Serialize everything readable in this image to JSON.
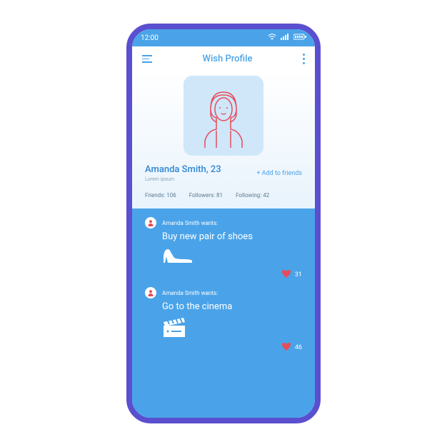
{
  "status": {
    "time": "12:00"
  },
  "header": {
    "title": "Wish Profile"
  },
  "profile": {
    "name": "Amanda Smith, 23",
    "subtitle": "Lorem ipsum",
    "add_friends": "+ Add to friends",
    "stats": {
      "friends": "Friends: 106",
      "followers": "Followers: 81",
      "following": "Following: 42"
    }
  },
  "wishes": [
    {
      "author": "Amanda Smith wants:",
      "title": "Buy new pair of shoes",
      "icon": "shoe",
      "likes": "31"
    },
    {
      "author": "Amanda Smith wants:",
      "title": "Go to the cinema",
      "icon": "clapper",
      "likes": "46"
    }
  ]
}
